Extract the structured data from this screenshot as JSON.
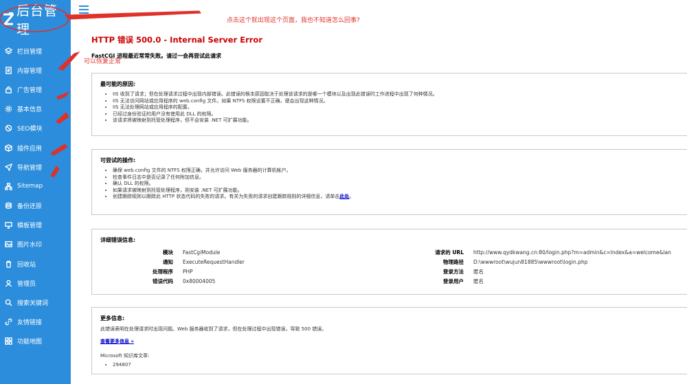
{
  "app": {
    "logo_text": "后台管理",
    "accent_color": "#2b8ddb"
  },
  "sidebar": {
    "items": [
      {
        "label": "栏目管理",
        "icon": "layers-icon"
      },
      {
        "label": "内容管理",
        "icon": "document-icon"
      },
      {
        "label": "广告管理",
        "icon": "lock-icon"
      },
      {
        "label": "基本信息",
        "icon": "gear-icon"
      },
      {
        "label": "SEO模块",
        "icon": "ban-icon"
      },
      {
        "label": "插件应用",
        "icon": "box-icon"
      },
      {
        "label": "导航管理",
        "icon": "send-icon"
      },
      {
        "label": "Sitemap",
        "icon": "sitemap-icon"
      },
      {
        "label": "备份还原",
        "icon": "database-icon"
      },
      {
        "label": "模板管理",
        "icon": "monitor-icon"
      },
      {
        "label": "图片水印",
        "icon": "image-icon"
      },
      {
        "label": "回收站",
        "icon": "trash-icon"
      },
      {
        "label": "管理员",
        "icon": "user-icon"
      },
      {
        "label": "搜索关键词",
        "icon": "search-icon"
      },
      {
        "label": "友情链接",
        "icon": "link-icon"
      },
      {
        "label": "功能地图",
        "icon": "grid-icon"
      }
    ]
  },
  "error": {
    "title": "HTTP 错误 500.0 - Internal Server Error",
    "subtitle": "FastCGI 进程最近常常失败。请过一会再尝试此请求",
    "causes_heading": "最可能的原因:",
    "causes": [
      "IIS 收到了请求；但在处理请求过程中出现内部错误。此错误的根本原因取决于处理该请求的是哪一个模块以及出现此错误时工作进程中出现了何种情况。",
      "IIS 无法访问网站或应用程序的 web.config 文件。如果 NTFS 权限设置不正确，便会出现这种情况。",
      "IIS 无法处理网站或应用程序的配置。",
      "已经过身份验证的用户没有使用此 DLL 的权限。",
      "该请求将被映射到托管处理程序，但不会安装 .NET 可扩展功能。"
    ],
    "actions_heading": "可尝试的操作:",
    "actions": [
      "确保 web.config 文件的 NTFS 权限正确，并允许访问 Web 服务器的计算机帐户。",
      "检查事件日志中是否记录了任何附加信息。",
      "确认 DLL 的权限。",
      "如果请求被映射到托管处理程序，则安装 .NET 可扩展功能。",
      "创建跟踪规则以跟踪此 HTTP 状态代码的失败的请求。有关为失败的请求创建跟踪规则的详细信息，请单击"
    ],
    "actions_link": "此处",
    "details_heading": "详细错误信息:",
    "details_left": [
      {
        "key": "模块",
        "value": "FastCgiModule"
      },
      {
        "key": "通知",
        "value": "ExecuteRequestHandler"
      },
      {
        "key": "处理程序",
        "value": "PHP"
      },
      {
        "key": "错误代码",
        "value": "0x80004005"
      }
    ],
    "details_right": [
      {
        "key": "请求的 URL",
        "value": "http://www.qydkwang.cn:80/login.php?m=admin&c=Index&a=welcome&lan"
      },
      {
        "key": "物理路径",
        "value": "D:\\wwwroot\\wujun81885\\wwwroot\\login.php"
      },
      {
        "key": "登录方法",
        "value": "匿名"
      },
      {
        "key": "登录用户",
        "value": "匿名"
      }
    ],
    "more_heading": "更多信息:",
    "more_text": "此错误表明在处理请求时出现问题。Web 服务器收到了请求，但在处理过程中出现错误，导致 500 错误。",
    "more_link": "查看更多信息 »",
    "kb_label": "Microsoft 知识库文章:",
    "kb_items": [
      "294807"
    ]
  },
  "annotations": {
    "top_note": "点击这个就出现这个页面，我也不知道怎么回事?",
    "side_note": "可以恢复正常",
    "color": "#e0302a"
  }
}
